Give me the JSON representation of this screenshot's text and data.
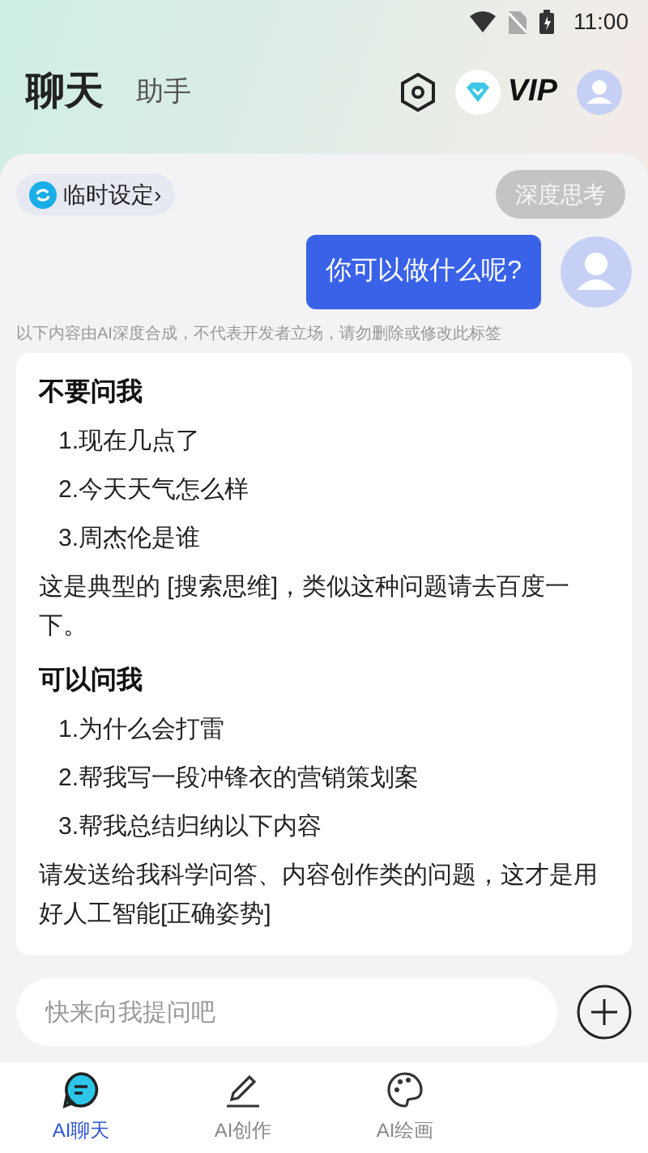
{
  "status_bar": {
    "time": "11:00"
  },
  "header": {
    "tabs": [
      {
        "label": "聊天",
        "selected": true
      },
      {
        "label": "助手",
        "selected": false
      }
    ],
    "vip": "VIP"
  },
  "chat": {
    "temp_settings": "临时设定",
    "chevron": "›",
    "deep_think": {
      "label": "深度思考",
      "on": false
    },
    "user_message": "你可以做什么呢?",
    "disclaimer": "以下内容由AI深度合成，不代表开发者立场，请勿删除或修改此标签",
    "answer": [
      {
        "kind": "heading",
        "text": "不要问我"
      },
      {
        "kind": "item",
        "text": "1.现在几点了"
      },
      {
        "kind": "item",
        "text": "2.今天天气怎么样"
      },
      {
        "kind": "item",
        "text": "3.周杰伦是谁"
      },
      {
        "kind": "para",
        "text": "这是典型的 [搜索思维]，类似这种问题请去百度一下。"
      },
      {
        "kind": "heading",
        "text": "可以问我"
      },
      {
        "kind": "item",
        "text": "1.为什么会打雷"
      },
      {
        "kind": "item",
        "text": "2.帮我写一段冲锋衣的营销策划案"
      },
      {
        "kind": "item",
        "text": "3.帮我总结归纳以下内容"
      },
      {
        "kind": "para",
        "text": "请发送给我科学问答、内容创作类的问题，这才是用好人工智能[正确姿势]"
      }
    ]
  },
  "input": {
    "placeholder": "快来向我提问吧"
  },
  "bottom_nav": [
    {
      "label": "AI聊天",
      "kind": "chat",
      "selected": true
    },
    {
      "label": "AI创作",
      "kind": "pen",
      "selected": false
    },
    {
      "label": "AI绘画",
      "kind": "palette",
      "selected": false
    }
  ]
}
